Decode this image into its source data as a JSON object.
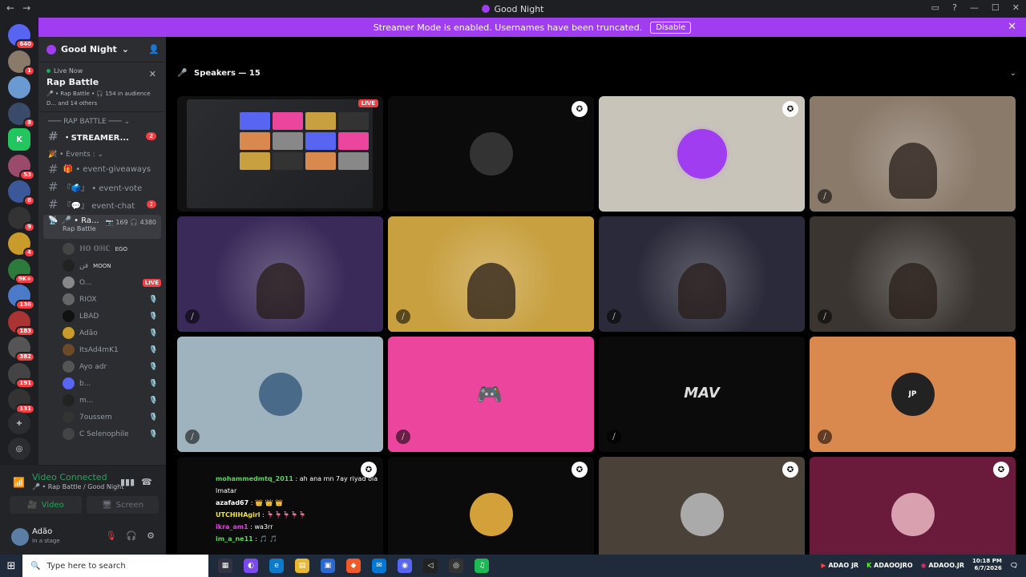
{
  "window": {
    "title": "Good Night",
    "nav_back": "←",
    "nav_fwd": "→"
  },
  "banner": {
    "text": "Streamer Mode is enabled. Usernames have been truncated.",
    "disable": "Disable",
    "close": "✕"
  },
  "servers": [
    {
      "label": "",
      "badge": "640",
      "color": "#5865f2"
    },
    {
      "label": "",
      "badge": "1",
      "color": "#8a7a6a"
    },
    {
      "label": "",
      "badge": "",
      "color": "#6a9ad1"
    },
    {
      "label": "",
      "badge": "8",
      "color": "#3a4b6a"
    },
    {
      "label": "K",
      "badge": "",
      "color": "#22c55e"
    },
    {
      "label": "",
      "badge": "53",
      "color": "#9a4a6a"
    },
    {
      "label": "",
      "badge": "8",
      "color": "#3b5998"
    },
    {
      "label": "",
      "badge": "9",
      "color": "#333"
    },
    {
      "label": "",
      "badge": "4",
      "color": "#c89b2a"
    },
    {
      "label": "",
      "badge": "9K+",
      "color": "#2d7a3d"
    },
    {
      "label": "",
      "badge": "136",
      "color": "#4a7ac8"
    },
    {
      "label": "",
      "badge": "183",
      "color": "#a33"
    },
    {
      "label": "",
      "badge": "382",
      "color": "#555"
    },
    {
      "label": "",
      "badge": "191",
      "color": "#444"
    },
    {
      "label": "",
      "badge": "131",
      "color": "#333"
    }
  ],
  "guild": {
    "name": "Good Night"
  },
  "live_card": {
    "live": "Live Now",
    "name": "Rap Battle",
    "meta": "🎤 • Rap Battle • 🎧 154 in audience",
    "others": "D... and 14 others",
    "close": "✕"
  },
  "categories": {
    "rap": "RAP BATTLE",
    "events": "Events :"
  },
  "channels": [
    {
      "name": "・STREAMER...",
      "badge": "2",
      "bold": true
    },
    {
      "name": "🎁 • event-giveaways",
      "badge": "",
      "bold": false
    },
    {
      "name": "『🗳️』 • event-vote",
      "badge": "",
      "bold": false
    },
    {
      "name": "『💬』 event-chat",
      "badge": "2",
      "bold": false
    }
  ],
  "stage": {
    "name": "🎤 • Ra...",
    "sub": "Rap Battle",
    "viewers": "169",
    "listeners": "4380"
  },
  "users": [
    {
      "name": "ℍ𝕆 𝕆ℍℂ",
      "extra": "EGO",
      "color": "#444",
      "right": ""
    },
    {
      "name": "فن",
      "extra": "MOON",
      "color": "#222",
      "right": ""
    },
    {
      "name": "O...",
      "extra": "",
      "color": "#888",
      "right": "LIVE"
    },
    {
      "name": "RIOX",
      "extra": "",
      "color": "#666",
      "right": "🎙️"
    },
    {
      "name": "LBAD",
      "extra": "",
      "color": "#111",
      "right": "🎙️"
    },
    {
      "name": "Adão",
      "extra": "",
      "color": "#c89b2a",
      "right": "🎙️"
    },
    {
      "name": "ItsAd4mK1",
      "extra": "",
      "color": "#6b4a2a",
      "right": "🎙️"
    },
    {
      "name": "Ayo adr",
      "extra": "",
      "color": "#555",
      "right": "🎙️"
    },
    {
      "name": "b...",
      "extra": "",
      "color": "#5865f2",
      "right": "🎙️"
    },
    {
      "name": "m...",
      "extra": "",
      "color": "#222",
      "right": "🎙️"
    },
    {
      "name": "7oussem",
      "extra": "",
      "color": "#333",
      "right": "🎙️"
    },
    {
      "name": "C Selenophile",
      "extra": "",
      "color": "#444",
      "right": "🎙️"
    }
  ],
  "voice": {
    "status": "Video Connected",
    "sub": "🎤 • Rap Battle / Good Night",
    "video": "Video",
    "screen": "Screen"
  },
  "user": {
    "name": "Adão",
    "status": "In a stage"
  },
  "speakers": {
    "label": "Speakers — 15"
  },
  "tiles": [
    {
      "bg": "#111",
      "type": "screen"
    },
    {
      "bg": "#0b0b0b",
      "type": "avatar",
      "avatar": "#333"
    },
    {
      "bg": "#c8c4ba",
      "type": "avatar",
      "avatar": "#a03df0"
    },
    {
      "bg": "#8a7a6a",
      "type": "cam"
    },
    {
      "bg": "#3a2a5a",
      "type": "cam"
    },
    {
      "bg": "#c8a040",
      "type": "cam"
    },
    {
      "bg": "#2a2a3a",
      "type": "cam"
    },
    {
      "bg": "#3a3530",
      "type": "cam"
    },
    {
      "bg": "#9fb3bf",
      "type": "avatar",
      "avatar": "#4a6a8a"
    },
    {
      "bg": "#eb459e",
      "type": "discord"
    },
    {
      "bg": "#0b0b0b",
      "type": "logo",
      "logo": "MAV"
    },
    {
      "bg": "#d9884e",
      "type": "avatar",
      "avatar": "#222",
      "logo": "JP"
    },
    {
      "bg": "#0b0b0b",
      "type": "chat"
    },
    {
      "bg": "#0b0b0b",
      "type": "avatar",
      "avatar": "#d4a03a"
    },
    {
      "bg": "#4a4238",
      "type": "avatar",
      "avatar": "#aaa"
    },
    {
      "bg": "#6a1a3a",
      "type": "avatar",
      "avatar": "#d9a0b0"
    }
  ],
  "chat_lines": [
    {
      "user": "mohammedmtq_2011",
      "msg": ": ah ana mn 7ay riyad ola lmatar",
      "color": "#5ad45a"
    },
    {
      "user": "azafad67",
      "msg": ": 👑 👑 👑",
      "color": "#fff"
    },
    {
      "user": "UTCHIHAgirl",
      "msg": ": 🦩🦩🦩🦩🦩",
      "color": "#f0e040"
    },
    {
      "user": "ikra_am1",
      "msg": ": wa3rr",
      "color": "#e040e0"
    },
    {
      "user": "im_a_ne11",
      "msg": ": 🎵 🎵",
      "color": "#5ad45a"
    }
  ],
  "live_label": "LIVE",
  "discord_logo": "🎮",
  "taskbar": {
    "search": "Type here to search",
    "tray1": "ADAO JR",
    "tray2": "ADAOOJRO",
    "tray3": "ADAOO.JR",
    "time": "10:18 PM",
    "date": "6/7/2026"
  }
}
